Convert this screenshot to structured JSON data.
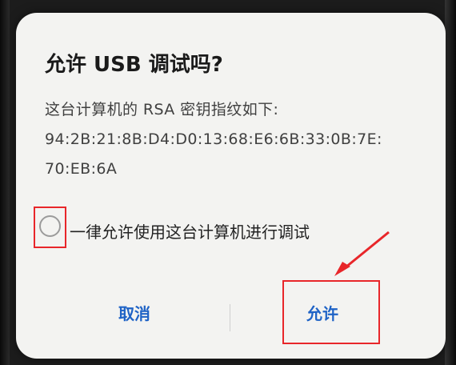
{
  "dialog": {
    "title": "允许 USB 调试吗?",
    "message_line1": "这台计算机的 RSA 密钥指纹如下:",
    "fingerprint_line1": "94:2B:21:8B:D4:D0:13:68:E6:6B:33:0B:7E:",
    "fingerprint_line2": "70:EB:6A",
    "always_allow_label": "一律允许使用这台计算机进行调试",
    "always_allow_checked": false,
    "cancel_label": "取消",
    "allow_label": "允许"
  },
  "colors": {
    "accent": "#1f63c6",
    "highlight": "#e8262a",
    "dialog_background": "#f3f3f1"
  }
}
